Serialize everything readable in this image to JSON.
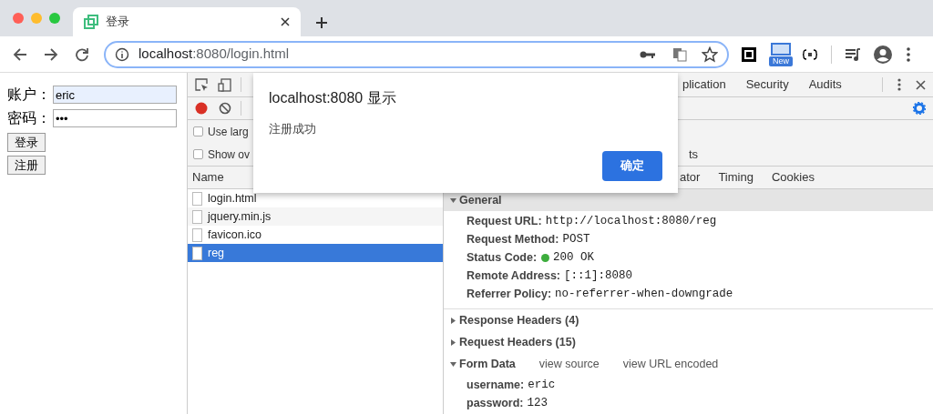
{
  "browser_tab": {
    "title": "登录"
  },
  "address_bar": {
    "host": "localhost",
    "path": ":8080/login.html"
  },
  "extension_badge": "New",
  "login_form": {
    "fields": [
      {
        "label": "账户：",
        "value": "eric",
        "autofilled": true
      },
      {
        "label": "密码：",
        "value": "•••",
        "autofilled": false
      }
    ],
    "buttons": [
      "登录",
      "注册"
    ]
  },
  "devtools": {
    "panel_tabs": [
      {
        "label": "plication"
      },
      {
        "label": "Security"
      },
      {
        "label": "Audits"
      }
    ],
    "options": [
      {
        "label": "Use larg",
        "checked": false
      },
      {
        "label": "Show ov",
        "checked": false
      }
    ],
    "option_fragment": "ts",
    "requests": {
      "column": "Name",
      "items": [
        {
          "name": "login.html",
          "selected": false
        },
        {
          "name": "jquery.min.js",
          "selected": false
        },
        {
          "name": "favicon.ico",
          "selected": false
        },
        {
          "name": "reg",
          "selected": true
        }
      ]
    },
    "detail_tabs": [
      "ator",
      "Timing",
      "Cookies"
    ],
    "sections": [
      {
        "title": "General",
        "expanded": true,
        "rows": [
          {
            "key": "Request URL:",
            "value": "http://localhost:8080/reg"
          },
          {
            "key": "Request Method:",
            "value": "POST"
          },
          {
            "key": "Status Code:",
            "value": "200 OK",
            "color": "#3dad3d"
          },
          {
            "key": "Remote Address:",
            "value": "[::1]:8080"
          },
          {
            "key": "Referrer Policy:",
            "value": "no-referrer-when-downgrade"
          }
        ]
      },
      {
        "title": "Response Headers (4)",
        "expanded": false
      },
      {
        "title": "Request Headers (15)",
        "expanded": false
      },
      {
        "title": "Form Data",
        "expanded": true,
        "links": [
          "view source",
          "view URL encoded"
        ],
        "rows": [
          {
            "key": "username:",
            "value": "eric"
          },
          {
            "key": "password:",
            "value": "123"
          }
        ]
      }
    ]
  },
  "dialog": {
    "title": "localhost:8080 显示",
    "message": "注册成功",
    "button": "确定"
  }
}
